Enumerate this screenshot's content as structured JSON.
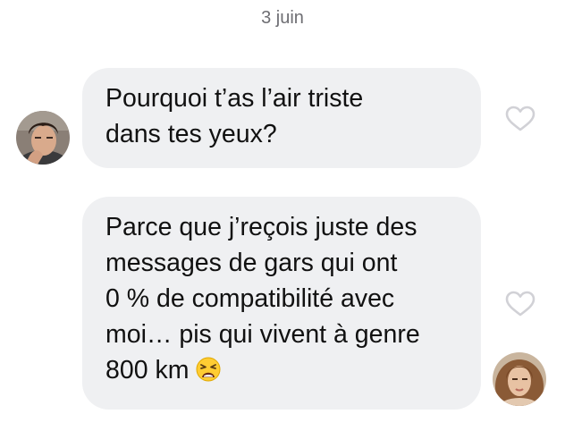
{
  "conversation": {
    "date_label": "3 juin",
    "messages": [
      {
        "lines": [
          "Pourquoi t’as l’air triste",
          "dans tes yeux?"
        ],
        "liked": false
      },
      {
        "lines": [
          "Parce que j’reçois juste des",
          "messages de gars qui ont",
          "0 % de compatibilité avec",
          "moi… pis qui vivent à genre",
          "800 km"
        ],
        "emoji": "weary-face-emoji",
        "liked": false
      }
    ]
  },
  "icons": {
    "like": "heart-outline-icon",
    "like_color": "#d1d1d6"
  },
  "colors": {
    "bubble_background": "#eff0f2",
    "text": "#111111",
    "date_text": "#6e6e73"
  }
}
